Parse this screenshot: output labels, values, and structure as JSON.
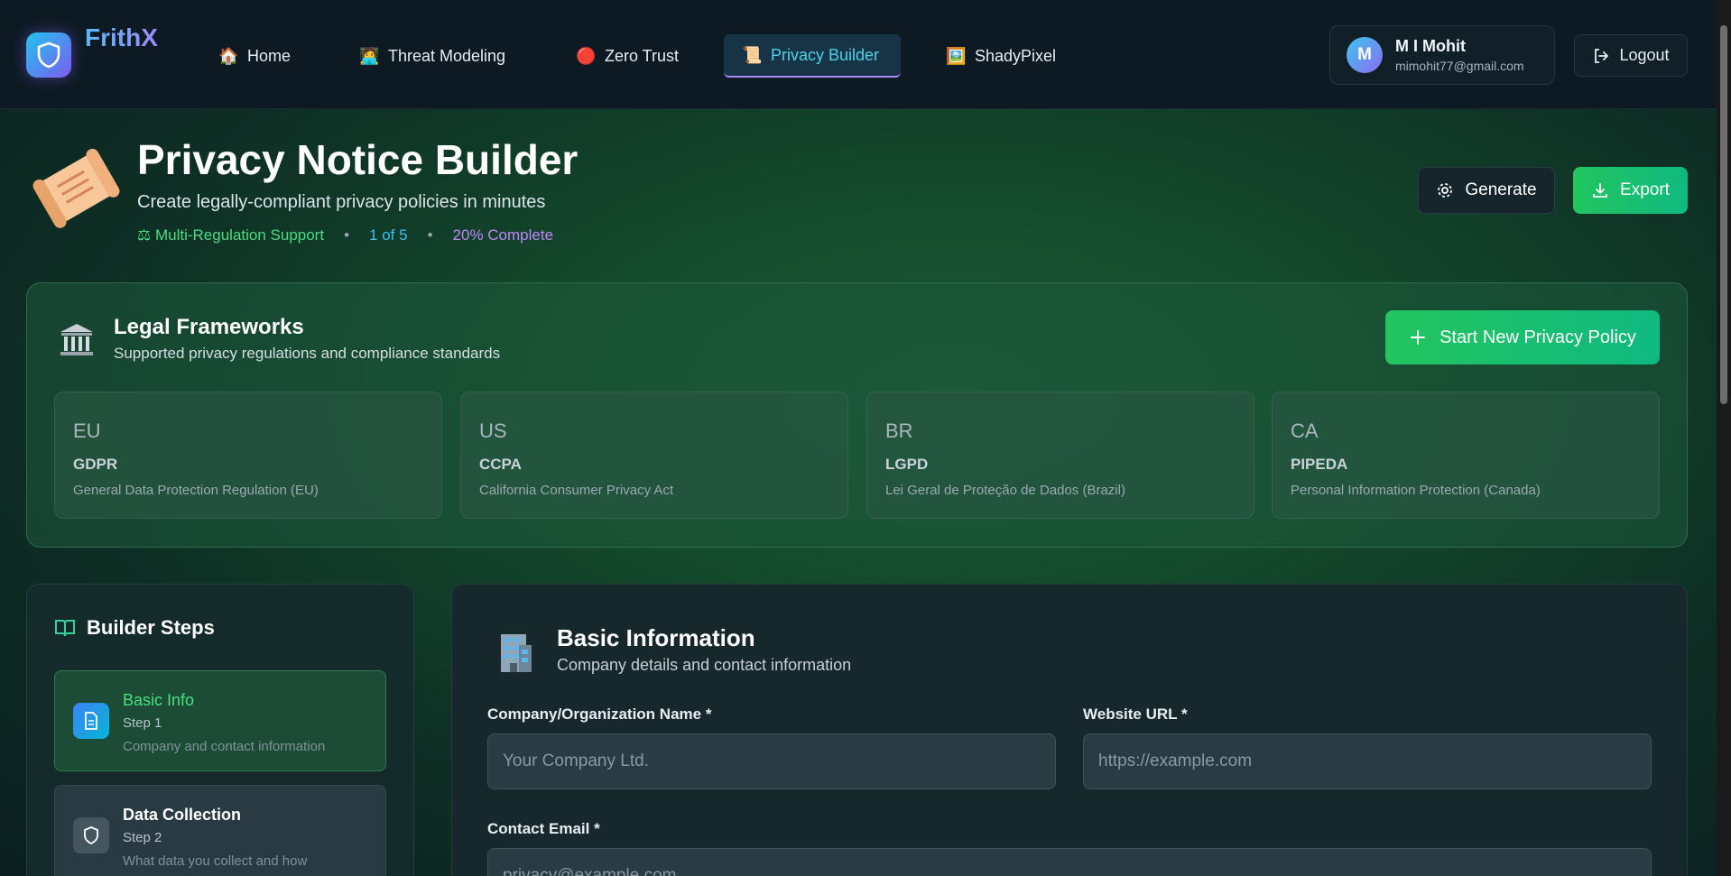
{
  "app": {
    "name": "FrithX"
  },
  "nav": {
    "items": [
      {
        "label": "Home",
        "icon": "🏠"
      },
      {
        "label": "Threat Modeling",
        "icon": "🧑‍💻"
      },
      {
        "label": "Zero Trust",
        "icon": "🔴"
      },
      {
        "label": "Privacy Builder",
        "icon": "📜"
      },
      {
        "label": "ShadyPixel",
        "icon": "🖼️"
      }
    ],
    "active": "Privacy Builder"
  },
  "user": {
    "initial": "M",
    "name": "M I Mohit",
    "email": "mimohit77@gmail.com"
  },
  "logout_label": "Logout",
  "header": {
    "title": "Privacy Notice Builder",
    "subtitle": "Create legally-compliant privacy policies in minutes",
    "meta": {
      "regulation": "Multi-Regulation Support",
      "progress_step": "1 of 5",
      "progress_percent": "20% Complete"
    },
    "generate_label": "Generate",
    "export_label": "Export"
  },
  "frameworks": {
    "title": "Legal Frameworks",
    "subtitle": "Supported privacy regulations and compliance standards",
    "start_label": "Start New Privacy Policy",
    "items": [
      {
        "code": "EU",
        "name": "GDPR",
        "desc": "General Data Protection Regulation (EU)"
      },
      {
        "code": "US",
        "name": "CCPA",
        "desc": "California Consumer Privacy Act"
      },
      {
        "code": "BR",
        "name": "LGPD",
        "desc": "Lei Geral de Proteção de Dados (Brazil)"
      },
      {
        "code": "CA",
        "name": "PIPEDA",
        "desc": "Personal Information Protection (Canada)"
      }
    ]
  },
  "steps": {
    "title": "Builder Steps",
    "items": [
      {
        "name": "Basic Info",
        "step": "Step 1",
        "desc": "Company and contact information"
      },
      {
        "name": "Data Collection",
        "step": "Step 2",
        "desc": "What data you collect and how"
      }
    ]
  },
  "form": {
    "title": "Basic Information",
    "subtitle": "Company details and contact information",
    "company_label": "Company/Organization Name *",
    "company_placeholder": "Your Company Ltd.",
    "website_label": "Website URL *",
    "website_placeholder": "https://example.com",
    "email_label": "Contact Email *",
    "email_placeholder": "privacy@example.com"
  },
  "colors": {
    "accent_green": "#22c55e",
    "accent_cyan": "#38bdf8",
    "accent_purple": "#c084fc"
  }
}
